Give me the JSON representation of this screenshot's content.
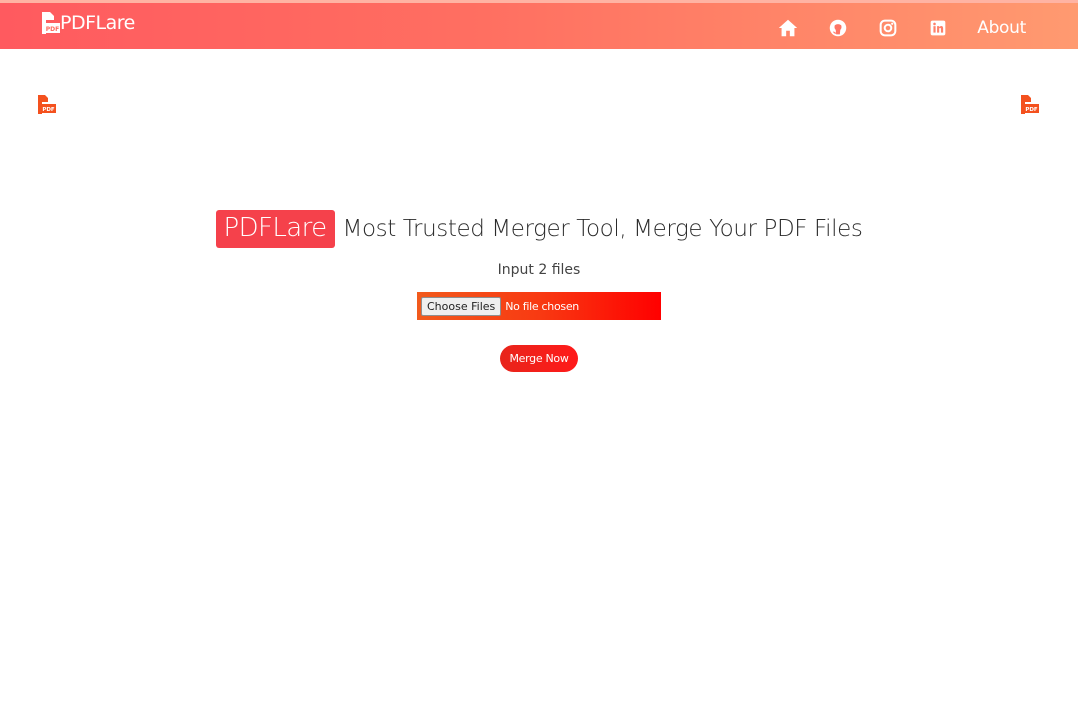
{
  "header": {
    "brand_name": "PDFLare",
    "nav": {
      "home_icon": "home-icon",
      "github_icon": "github-icon",
      "instagram_icon": "instagram-icon",
      "linkedin_icon": "linkedin-icon",
      "about_label": "About"
    },
    "colors": {
      "gradient_start": "#ff5a5f",
      "gradient_end": "#ff9a70"
    }
  },
  "decor": {
    "left_logo_icon": "pdf-file-icon",
    "right_logo_icon": "pdf-file-icon",
    "logo_color": "#f4511e"
  },
  "hero": {
    "badge": "PDFLare",
    "title": "Most Trusted Merger Tool, Merge Your PDF Files",
    "subtitle": "Input 2 files",
    "badge_color": "#f5414b"
  },
  "upload": {
    "choose_label": "Choose Files",
    "status": "No file chosen"
  },
  "actions": {
    "merge_label": "Merge Now"
  }
}
